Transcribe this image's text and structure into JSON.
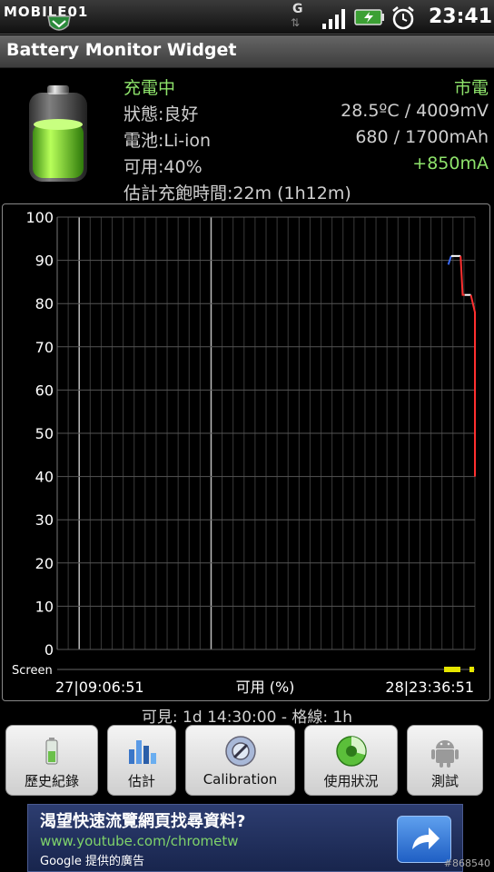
{
  "statusbar": {
    "logo": "MOBILE01",
    "network": "G",
    "time": "23:41"
  },
  "title": "Battery Monitor Widget",
  "info": {
    "status": "充電中",
    "source": "市電",
    "health": "狀態:良好",
    "temp_voltage": "28.5ºC / 4009mV",
    "battery_type": "電池:Li-ion",
    "capacity": "680 / 1700mAh",
    "available": "可用:40%",
    "current": "+850mA",
    "estimate": "估計充飽時間:22m (1h12m)"
  },
  "chart_data": {
    "type": "line",
    "yticks": [
      0,
      10,
      20,
      30,
      40,
      50,
      60,
      70,
      80,
      90,
      100
    ],
    "ylim": [
      0,
      100
    ],
    "xstart_label": "27|09:06:51",
    "xend_label": "28|23:36:51",
    "xlabel": "可用 (%)",
    "screen_label": "Screen",
    "series": [
      {
        "color": "#3a6cff",
        "points": [
          [
            0.955,
            89
          ],
          [
            0.962,
            91
          ]
        ]
      },
      {
        "color": "#ffffff",
        "points": [
          [
            0.962,
            91
          ],
          [
            0.985,
            91
          ]
        ]
      },
      {
        "color": "#ff3030",
        "points": [
          [
            0.985,
            91
          ],
          [
            0.99,
            82
          ],
          [
            0.995,
            82
          ]
        ]
      },
      {
        "color": "#ffffff",
        "points": [
          [
            0.995,
            82
          ],
          [
            1.01,
            82
          ]
        ]
      },
      {
        "color": "#ff3030",
        "points": [
          [
            1.01,
            82
          ],
          [
            1.015,
            80
          ],
          [
            1.02,
            78
          ],
          [
            1.02,
            40
          ]
        ]
      }
    ]
  },
  "footer": {
    "visible": "可見: 1d 14:30:00 - 格線: 1h"
  },
  "buttons": [
    {
      "label": "歷史紀錄"
    },
    {
      "label": "估計"
    },
    {
      "label": "Calibration"
    },
    {
      "label": "使用狀況"
    },
    {
      "label": "測試"
    }
  ],
  "ad": {
    "title": "渴望快速流覽網頁找尋資料?",
    "url": "www.youtube.com/chrometw",
    "by": "Google 提供的廣告"
  },
  "watermark": "#868540",
  "colors": {
    "green_text": "#8ee36b",
    "charge_line": "#ff3030",
    "ad_bg": "#1f2f60"
  }
}
